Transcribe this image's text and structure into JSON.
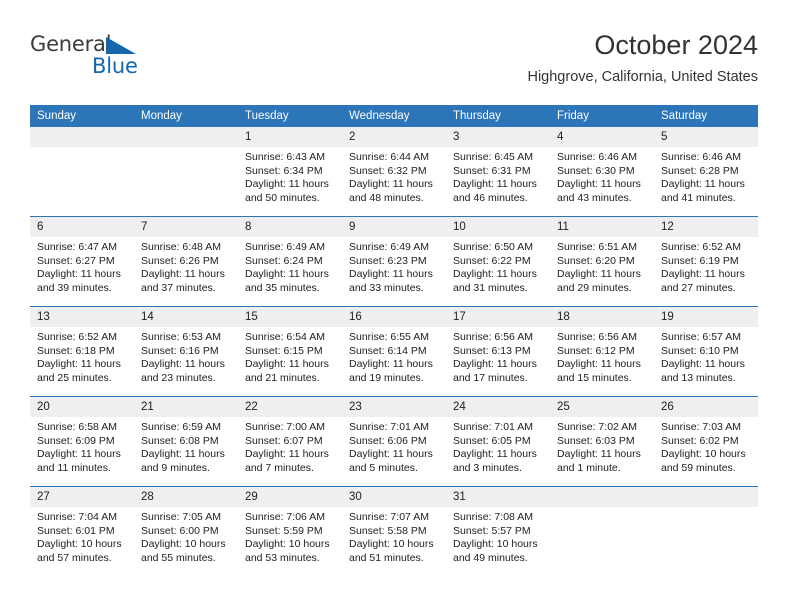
{
  "logo": {
    "word1": "General",
    "word2": "Blue",
    "triangle_color": "#1566ad"
  },
  "header": {
    "title": "October 2024",
    "location": "Highgrove, California, United States"
  },
  "theme": {
    "header_bg": "#2b75b8",
    "daynum_bg": "#efefef",
    "row_divider": "#2b75b8"
  },
  "weekdays": [
    "Sunday",
    "Monday",
    "Tuesday",
    "Wednesday",
    "Thursday",
    "Friday",
    "Saturday"
  ],
  "weeks": [
    [
      {
        "day": "",
        "sunrise": "",
        "sunset": "",
        "daylight": ""
      },
      {
        "day": "",
        "sunrise": "",
        "sunset": "",
        "daylight": ""
      },
      {
        "day": "1",
        "sunrise": "Sunrise: 6:43 AM",
        "sunset": "Sunset: 6:34 PM",
        "daylight": "Daylight: 11 hours and 50 minutes."
      },
      {
        "day": "2",
        "sunrise": "Sunrise: 6:44 AM",
        "sunset": "Sunset: 6:32 PM",
        "daylight": "Daylight: 11 hours and 48 minutes."
      },
      {
        "day": "3",
        "sunrise": "Sunrise: 6:45 AM",
        "sunset": "Sunset: 6:31 PM",
        "daylight": "Daylight: 11 hours and 46 minutes."
      },
      {
        "day": "4",
        "sunrise": "Sunrise: 6:46 AM",
        "sunset": "Sunset: 6:30 PM",
        "daylight": "Daylight: 11 hours and 43 minutes."
      },
      {
        "day": "5",
        "sunrise": "Sunrise: 6:46 AM",
        "sunset": "Sunset: 6:28 PM",
        "daylight": "Daylight: 11 hours and 41 minutes."
      }
    ],
    [
      {
        "day": "6",
        "sunrise": "Sunrise: 6:47 AM",
        "sunset": "Sunset: 6:27 PM",
        "daylight": "Daylight: 11 hours and 39 minutes."
      },
      {
        "day": "7",
        "sunrise": "Sunrise: 6:48 AM",
        "sunset": "Sunset: 6:26 PM",
        "daylight": "Daylight: 11 hours and 37 minutes."
      },
      {
        "day": "8",
        "sunrise": "Sunrise: 6:49 AM",
        "sunset": "Sunset: 6:24 PM",
        "daylight": "Daylight: 11 hours and 35 minutes."
      },
      {
        "day": "9",
        "sunrise": "Sunrise: 6:49 AM",
        "sunset": "Sunset: 6:23 PM",
        "daylight": "Daylight: 11 hours and 33 minutes."
      },
      {
        "day": "10",
        "sunrise": "Sunrise: 6:50 AM",
        "sunset": "Sunset: 6:22 PM",
        "daylight": "Daylight: 11 hours and 31 minutes."
      },
      {
        "day": "11",
        "sunrise": "Sunrise: 6:51 AM",
        "sunset": "Sunset: 6:20 PM",
        "daylight": "Daylight: 11 hours and 29 minutes."
      },
      {
        "day": "12",
        "sunrise": "Sunrise: 6:52 AM",
        "sunset": "Sunset: 6:19 PM",
        "daylight": "Daylight: 11 hours and 27 minutes."
      }
    ],
    [
      {
        "day": "13",
        "sunrise": "Sunrise: 6:52 AM",
        "sunset": "Sunset: 6:18 PM",
        "daylight": "Daylight: 11 hours and 25 minutes."
      },
      {
        "day": "14",
        "sunrise": "Sunrise: 6:53 AM",
        "sunset": "Sunset: 6:16 PM",
        "daylight": "Daylight: 11 hours and 23 minutes."
      },
      {
        "day": "15",
        "sunrise": "Sunrise: 6:54 AM",
        "sunset": "Sunset: 6:15 PM",
        "daylight": "Daylight: 11 hours and 21 minutes."
      },
      {
        "day": "16",
        "sunrise": "Sunrise: 6:55 AM",
        "sunset": "Sunset: 6:14 PM",
        "daylight": "Daylight: 11 hours and 19 minutes."
      },
      {
        "day": "17",
        "sunrise": "Sunrise: 6:56 AM",
        "sunset": "Sunset: 6:13 PM",
        "daylight": "Daylight: 11 hours and 17 minutes."
      },
      {
        "day": "18",
        "sunrise": "Sunrise: 6:56 AM",
        "sunset": "Sunset: 6:12 PM",
        "daylight": "Daylight: 11 hours and 15 minutes."
      },
      {
        "day": "19",
        "sunrise": "Sunrise: 6:57 AM",
        "sunset": "Sunset: 6:10 PM",
        "daylight": "Daylight: 11 hours and 13 minutes."
      }
    ],
    [
      {
        "day": "20",
        "sunrise": "Sunrise: 6:58 AM",
        "sunset": "Sunset: 6:09 PM",
        "daylight": "Daylight: 11 hours and 11 minutes."
      },
      {
        "day": "21",
        "sunrise": "Sunrise: 6:59 AM",
        "sunset": "Sunset: 6:08 PM",
        "daylight": "Daylight: 11 hours and 9 minutes."
      },
      {
        "day": "22",
        "sunrise": "Sunrise: 7:00 AM",
        "sunset": "Sunset: 6:07 PM",
        "daylight": "Daylight: 11 hours and 7 minutes."
      },
      {
        "day": "23",
        "sunrise": "Sunrise: 7:01 AM",
        "sunset": "Sunset: 6:06 PM",
        "daylight": "Daylight: 11 hours and 5 minutes."
      },
      {
        "day": "24",
        "sunrise": "Sunrise: 7:01 AM",
        "sunset": "Sunset: 6:05 PM",
        "daylight": "Daylight: 11 hours and 3 minutes."
      },
      {
        "day": "25",
        "sunrise": "Sunrise: 7:02 AM",
        "sunset": "Sunset: 6:03 PM",
        "daylight": "Daylight: 11 hours and 1 minute."
      },
      {
        "day": "26",
        "sunrise": "Sunrise: 7:03 AM",
        "sunset": "Sunset: 6:02 PM",
        "daylight": "Daylight: 10 hours and 59 minutes."
      }
    ],
    [
      {
        "day": "27",
        "sunrise": "Sunrise: 7:04 AM",
        "sunset": "Sunset: 6:01 PM",
        "daylight": "Daylight: 10 hours and 57 minutes."
      },
      {
        "day": "28",
        "sunrise": "Sunrise: 7:05 AM",
        "sunset": "Sunset: 6:00 PM",
        "daylight": "Daylight: 10 hours and 55 minutes."
      },
      {
        "day": "29",
        "sunrise": "Sunrise: 7:06 AM",
        "sunset": "Sunset: 5:59 PM",
        "daylight": "Daylight: 10 hours and 53 minutes."
      },
      {
        "day": "30",
        "sunrise": "Sunrise: 7:07 AM",
        "sunset": "Sunset: 5:58 PM",
        "daylight": "Daylight: 10 hours and 51 minutes."
      },
      {
        "day": "31",
        "sunrise": "Sunrise: 7:08 AM",
        "sunset": "Sunset: 5:57 PM",
        "daylight": "Daylight: 10 hours and 49 minutes."
      },
      {
        "day": "",
        "sunrise": "",
        "sunset": "",
        "daylight": ""
      },
      {
        "day": "",
        "sunrise": "",
        "sunset": "",
        "daylight": ""
      }
    ]
  ]
}
